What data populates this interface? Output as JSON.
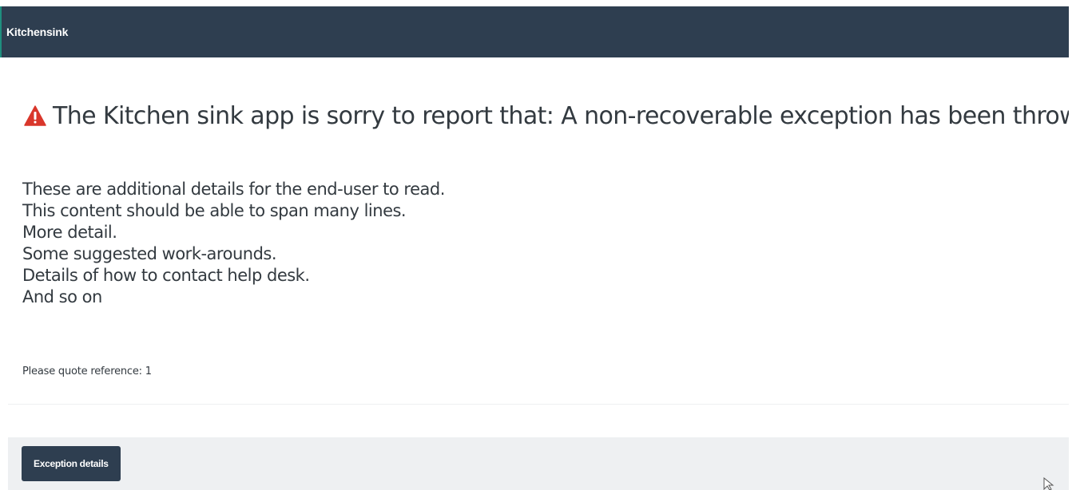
{
  "app": {
    "brand": "Kitchensink"
  },
  "error": {
    "icon": "warning-triangle-icon",
    "icon_color": "#d9362b",
    "headline": "The Kitchen sink app is sorry to report that: A non-recoverable exception has been thrown",
    "details": [
      "These are additional details for the end-user to read.",
      "This content should be able to span many lines.",
      "More detail.",
      "Some suggested work-arounds.",
      "Details of how to contact help desk.",
      "And so on"
    ],
    "reference": "Please quote reference: 1"
  },
  "footer": {
    "exception_button_label": "Exception details"
  },
  "colors": {
    "navbar": "#2e3e50",
    "footer_bg": "#eef0f2",
    "text": "#333a40"
  }
}
